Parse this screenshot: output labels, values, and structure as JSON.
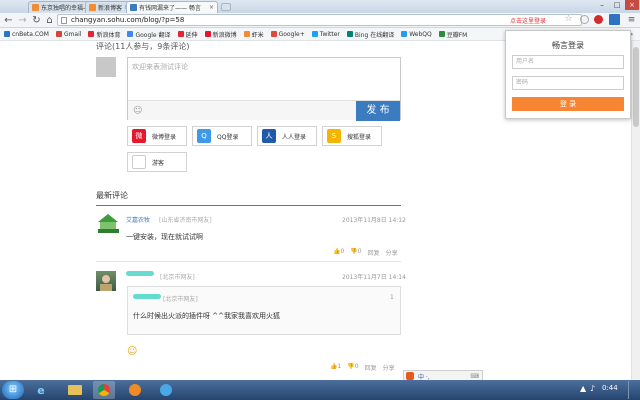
{
  "browser": {
    "tabs": [
      {
        "label": "东京独唱的幸福——虾米",
        "icon_color": "#f28d33"
      },
      {
        "label": "新浪博客",
        "icon_color": "#f28d33"
      },
      {
        "label": "有钱网漏来了—— 畅言",
        "icon_color": "#3b7bbf"
      }
    ],
    "tab_close": "×",
    "url": "changyan.sohu.com/blog/?p=58",
    "login_hint": "点击这里登录",
    "window_min": "–",
    "window_max": "□",
    "window_close": "×",
    "bookmarks": [
      {
        "label": "cnBeta.COM",
        "color": "#2a74c5"
      },
      {
        "label": "Gmail",
        "color": "#d44638"
      },
      {
        "label": "新浪体育",
        "color": "#e3262d"
      },
      {
        "label": "Google 翻译",
        "color": "#4285f4"
      },
      {
        "label": "延伸",
        "color": "#e3262d"
      },
      {
        "label": "新浪微博",
        "color": "#e6162d"
      },
      {
        "label": "虾米",
        "color": "#f28d33"
      },
      {
        "label": "Google+",
        "color": "#dd4b39"
      },
      {
        "label": "Twitter",
        "color": "#1da1f2"
      },
      {
        "label": "Bing 在线翻译",
        "color": "#008373"
      },
      {
        "label": "WebQQ",
        "color": "#2a9be6"
      },
      {
        "label": "豆瓣FM",
        "color": "#2a8f3c"
      },
      {
        "label": "»",
        "color": "#ffffff"
      }
    ]
  },
  "comments_section": {
    "heading": "评论(11人参与，9条评论)",
    "editor_placeholder": "欢迎来表测试评论",
    "publish_label": "发 布",
    "social_logins": [
      {
        "label": "微博登录",
        "icon": "weibo-icon",
        "color": "#e6162d",
        "glyph": "微"
      },
      {
        "label": "QQ登录",
        "icon": "qq-icon",
        "color": "#3d9ae8",
        "glyph": "Q"
      },
      {
        "label": "人人登录",
        "icon": "renren-icon",
        "color": "#1f5ba8",
        "glyph": "人"
      },
      {
        "label": "搜狐登录",
        "icon": "sohu-icon",
        "color": "#f4b400",
        "glyph": "S"
      },
      {
        "label": "游客",
        "icon": "guest-icon",
        "color": "#cccccc",
        "glyph": ""
      }
    ],
    "latest_heading": "最新评论",
    "comments": [
      {
        "name": "艾嘉农牧",
        "location": "[山东省济南市网友]",
        "time": "2013年11月8日 14:12",
        "text": "一键安装，现在就试试啊",
        "actions": [
          "0",
          "0",
          "回复",
          "分享"
        ]
      },
      {
        "name": "",
        "location": "[北京市网友]",
        "time": "2013年11月7日 14:14",
        "quote_location": "[北京市网友]",
        "quote_index": "1",
        "quote_text": "什么时候出火派的插件呀 ^^我家我喜欢用火狐",
        "actions": [
          "1",
          "0",
          "回复",
          "分享"
        ]
      }
    ]
  },
  "login_popup": {
    "title": "畅言登录",
    "username_placeholder": "用户名",
    "password_placeholder": "密码",
    "login_label": "登 录"
  },
  "taskbar": {
    "clock": "0:44",
    "ime": "中 ·,"
  }
}
